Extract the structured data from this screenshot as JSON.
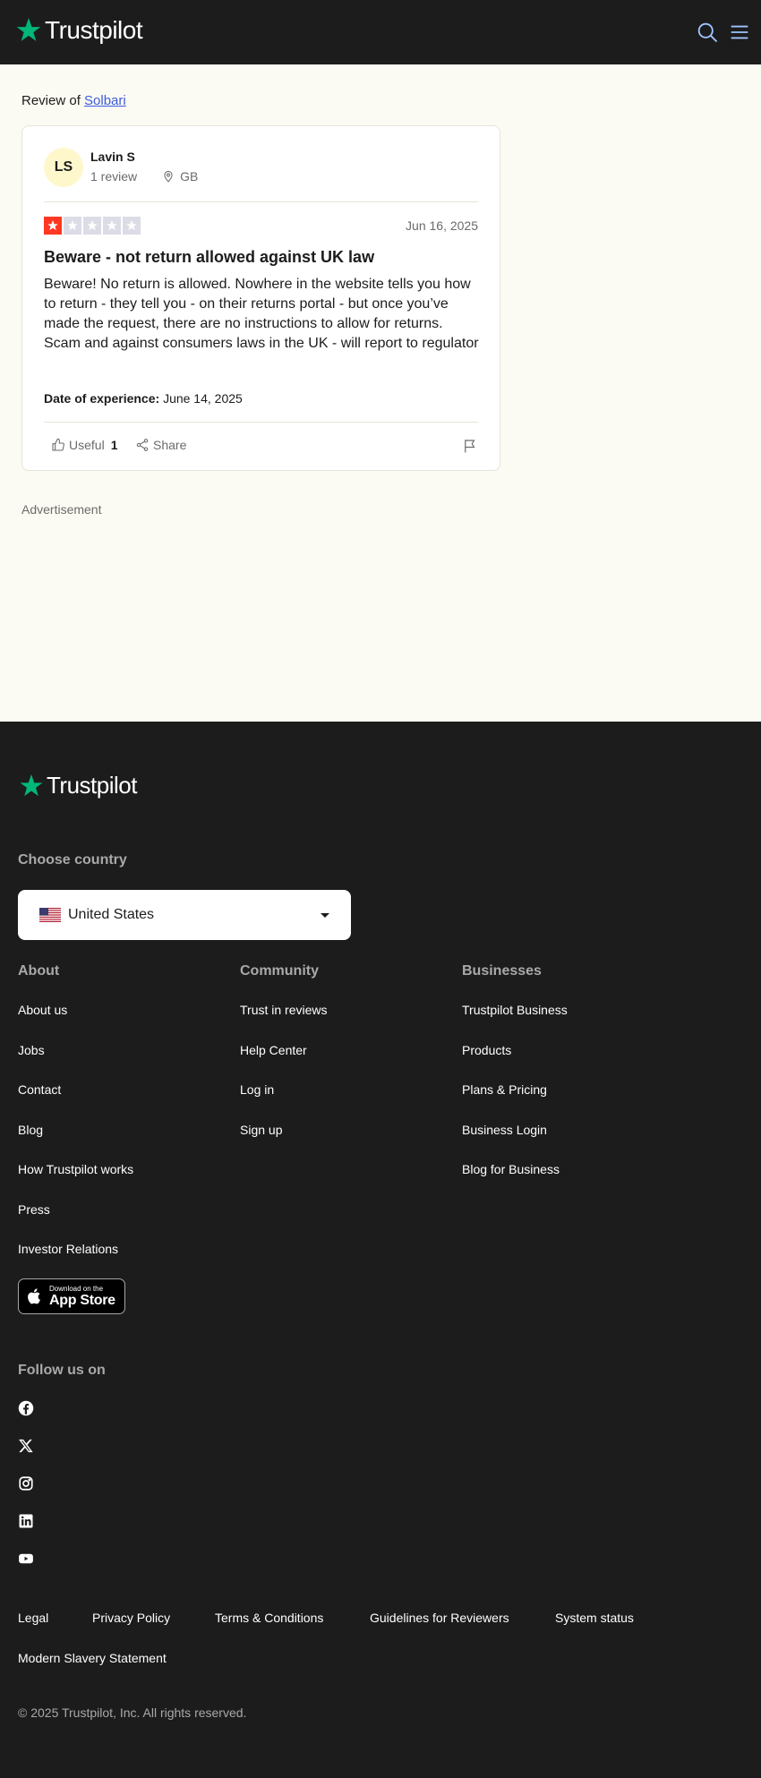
{
  "header": {
    "logo_text": "Trustpilot",
    "search_icon": "search-icon",
    "menu_icon": "hamburger-menu-icon"
  },
  "review_of": {
    "prefix": "Review of",
    "company": "Solbari"
  },
  "review": {
    "avatar_initials": "LS",
    "reviewer_name": "Lavin S",
    "review_count": "1 review",
    "country": "GB",
    "rating": 1,
    "max_rating": 5,
    "date": "Jun 16, 2025",
    "title": "Beware - not return allowed against UK law",
    "body": "Beware! No return is allowed. Nowhere in the website tells you how to return - they tell you - on their returns portal - but once you’ve made the request, there are no instructions to allow for returns. Scam and against consumers laws in the UK - will report to regulator",
    "date_of_experience_label": "Date of experience:",
    "date_of_experience": "June 14, 2025",
    "useful_label": "Useful",
    "useful_count": "1",
    "share_label": "Share"
  },
  "advertisement_label": "Advertisement",
  "footer": {
    "logo_text": "Trustpilot",
    "choose_country_label": "Choose country",
    "selected_country": "United States",
    "columns": {
      "about": {
        "heading": "About",
        "links": [
          "About us",
          "Jobs",
          "Contact",
          "Blog",
          "How Trustpilot works",
          "Press",
          "Investor Relations"
        ]
      },
      "community": {
        "heading": "Community",
        "links": [
          "Trust in reviews",
          "Help Center",
          "Log in",
          "Sign up"
        ]
      },
      "businesses": {
        "heading": "Businesses",
        "links": [
          "Trustpilot Business",
          "Products",
          "Plans & Pricing",
          "Business Login",
          "Blog for Business"
        ]
      }
    },
    "app_store": {
      "small_text": "Download on the",
      "big_text": "App Store"
    },
    "follow_label": "Follow us on",
    "social_icons": [
      "facebook-icon",
      "x-twitter-icon",
      "instagram-icon",
      "linkedin-icon",
      "youtube-icon"
    ],
    "legal_links": [
      "Legal",
      "Privacy Policy",
      "Terms & Conditions",
      "Guidelines for Reviewers",
      "System status",
      "Modern Slavery Statement"
    ],
    "copyright": "© 2025 Trustpilot, Inc. All rights reserved."
  },
  "colors": {
    "brand_green": "#00b67a",
    "star_red": "#ff3722",
    "link_blue": "#3b5bdb",
    "dark_bg": "#1c1c1c",
    "page_bg": "#fcfbf3"
  }
}
